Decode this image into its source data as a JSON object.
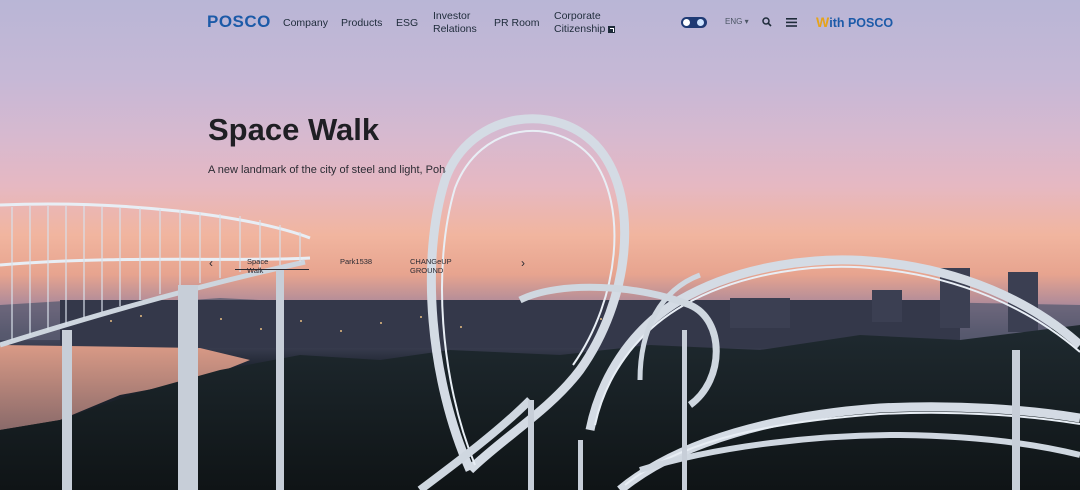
{
  "header": {
    "logo": "POSCO",
    "nav": [
      {
        "label": "Company"
      },
      {
        "label": "Products"
      },
      {
        "label": "ESG"
      },
      {
        "label": "Investor Relations",
        "line1": "Investor",
        "line2": "Relations"
      },
      {
        "label": "PR Room"
      },
      {
        "label": "Corporate Citizenship",
        "line1": "Corporate",
        "line2": "Citizenship",
        "external": true
      }
    ],
    "language": "ENG",
    "with_posco_w": "W",
    "with_posco_rest": "ith POSCO"
  },
  "hero": {
    "title": "Space Walk",
    "subtitle": "A new landmark of the city of steel and light, Pohang"
  },
  "slides": {
    "items": [
      "Space Walk",
      "Park1538",
      "CHANGeUP GROUND"
    ],
    "active_index": 0
  },
  "colors": {
    "brand_blue": "#1c5aa8",
    "brand_orange": "#e6a31b",
    "toggle_bg": "#1f3a74"
  },
  "icons": [
    "theme-toggle-icon",
    "search-icon",
    "menu-icon",
    "chevron-left-icon",
    "chevron-right-icon",
    "external-link-icon"
  ]
}
